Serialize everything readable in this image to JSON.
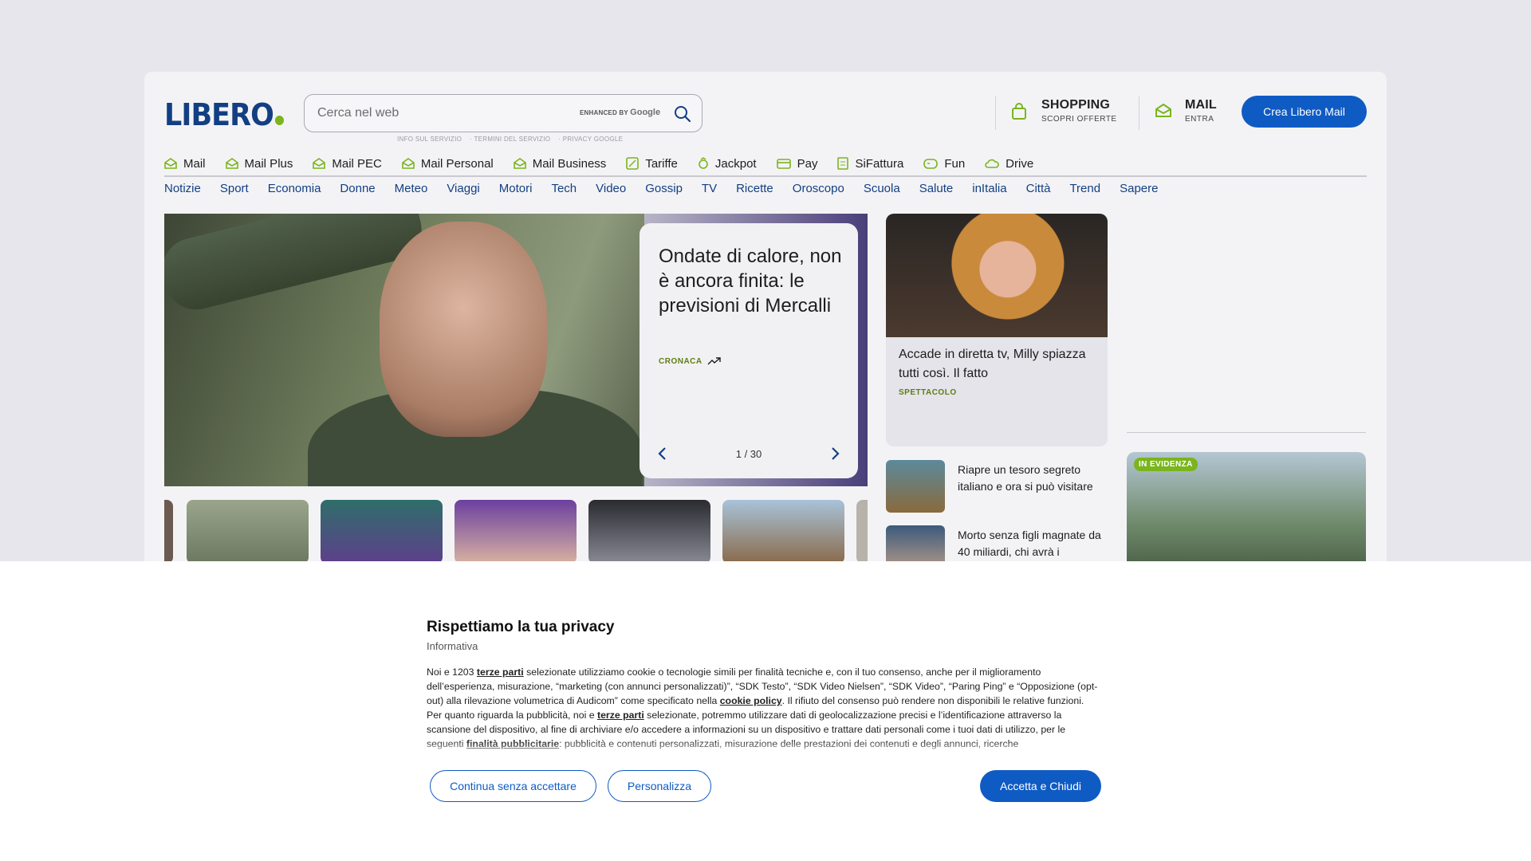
{
  "header": {
    "logo": "LIBERO",
    "search_placeholder": "Cerca nel web",
    "enhanced_by": "ENHANCED BY",
    "google": "Google",
    "sub_links": [
      "INFO SUL SERVIZIO",
      "TERMINI DEL SERVIZIO",
      "PRIVACY GOOGLE"
    ],
    "shopping": {
      "title": "SHOPPING",
      "subtitle": "SCOPRI OFFERTE"
    },
    "mail": {
      "title": "MAIL",
      "subtitle": "ENTRA"
    },
    "cta": "Crea Libero Mail"
  },
  "services": [
    "Mail",
    "Mail Plus",
    "Mail PEC",
    "Mail Personal",
    "Mail Business",
    "Tariffe",
    "Jackpot",
    "Pay",
    "SiFattura",
    "Fun",
    "Drive"
  ],
  "categories": [
    "Notizie",
    "Sport",
    "Economia",
    "Donne",
    "Meteo",
    "Viaggi",
    "Motori",
    "Tech",
    "Video",
    "Gossip",
    "TV",
    "Ricette",
    "Oroscopo",
    "Scuola",
    "Salute",
    "inItalia",
    "Città",
    "Trend",
    "Sapere"
  ],
  "hero": {
    "headline": "Ondate di calore, non è ancora finita: le previsioni di Mercalli",
    "tag": "CRONACA",
    "pager": "1 / 30"
  },
  "side_story": {
    "headline": "Accade in diretta tv, Milly spiazza tutti così. Il fatto",
    "tag": "SPETTACOLO"
  },
  "news": [
    {
      "title": "Riapre un tesoro segreto italiano e ora si può visitare"
    },
    {
      "title": "Morto senza figli magnate da 40 miliardi, chi avrà i"
    }
  ],
  "promo": {
    "badge": "IN EVIDENZA"
  },
  "privacy": {
    "title": "Rispettiamo la tua privacy",
    "subtitle": "Informativa",
    "p1_a": "Noi e 1203 ",
    "p1_link": "terze parti",
    "p1_b": " selezionate utilizziamo cookie o tecnologie simili per finalità tecniche e, con il tuo consenso, anche per il miglioramento dell’esperienza, misurazione, “marketing (con annunci personalizzati)”, “SDK Testo”, “SDK Video Nielsen”, “SDK Video”, “Paring Ping” e “Opposizione (opt-out) alla rilevazione volumetrica di Audicom” come specificato nella ",
    "p1_link2": "cookie policy",
    "p1_c": ". Il rifiuto del consenso può rendere non disponibili le relative funzioni.",
    "p2_a": "Per quanto riguarda la pubblicità, noi e ",
    "p2_link": "terze parti",
    "p2_b": " selezionate, potremmo utilizzare dati di geolocalizzazione precisi e l’identificazione attraverso la scansione del dispositivo, al fine di archiviare e/o accedere a informazioni su un dispositivo e trattare dati personali come i tuoi dati di utilizzo, per le seguenti ",
    "p2_link2": "finalità pubblicitarie",
    "p2_c": ": pubblicità e contenuti personalizzati, misurazione delle prestazioni dei contenuti e degli annunci, ricerche",
    "btn_continue": "Continua senza accettare",
    "btn_customize": "Personalizza",
    "btn_accept": "Accetta e Chiudi"
  },
  "colors": {
    "brand": "#133f82",
    "accent": "#0f5bc4",
    "green": "#7ab51d"
  }
}
